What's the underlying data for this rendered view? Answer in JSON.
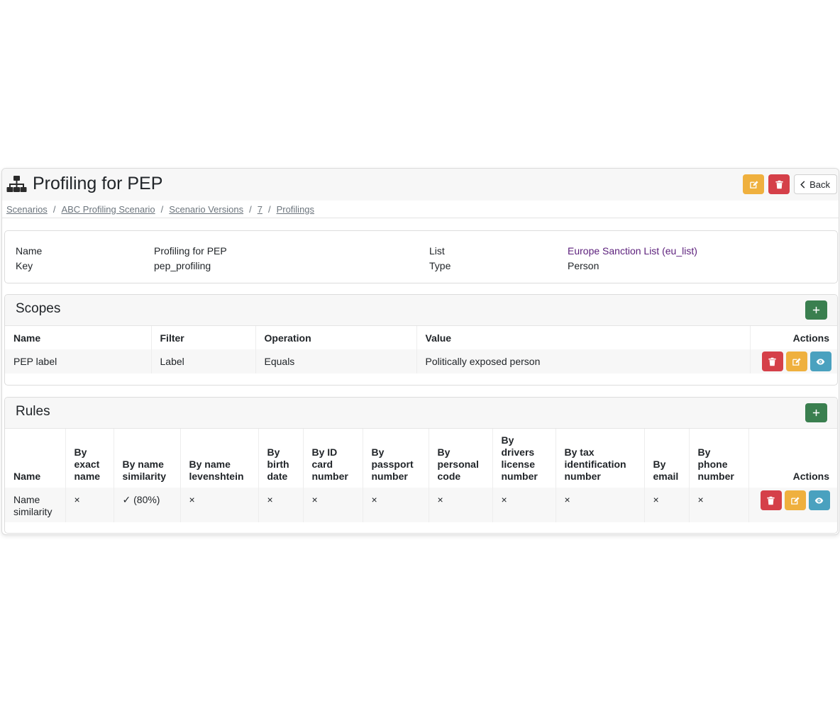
{
  "header": {
    "title": "Profiling for PEP",
    "back_label": "Back"
  },
  "breadcrumb": [
    "Scenarios",
    "ABC Profiling Scenario",
    "Scenario Versions",
    "7",
    "Profilings"
  ],
  "details": {
    "name_label": "Name",
    "name_value": "Profiling for PEP",
    "key_label": "Key",
    "key_value": "pep_profiling",
    "list_label": "List",
    "list_value": "Europe Sanction List (eu_list)",
    "type_label": "Type",
    "type_value": "Person"
  },
  "scopes": {
    "title": "Scopes",
    "columns": [
      "Name",
      "Filter",
      "Operation",
      "Value",
      "Actions"
    ],
    "rows": [
      {
        "name": "PEP label",
        "filter": "Label",
        "operation": "Equals",
        "value": "Politically exposed person"
      }
    ]
  },
  "rules": {
    "title": "Rules",
    "columns": [
      "Name",
      "By exact name",
      "By name similarity",
      "By name levenshtein",
      "By birth date",
      "By ID card number",
      "By passport number",
      "By personal code",
      "By drivers license number",
      "By tax identification number",
      "By email",
      "By phone number",
      "Actions"
    ],
    "rows": [
      {
        "cells": [
          "Name similarity",
          "×",
          "✓ (80%)",
          "×",
          "×",
          "×",
          "×",
          "×",
          "×",
          "×",
          "×",
          "×"
        ]
      }
    ]
  },
  "colors": {
    "warning": "#efb03e",
    "danger": "#d54049",
    "info": "#4aa1bf",
    "success": "#3a7f4f",
    "link": "#5b1e7b"
  },
  "icons": {
    "title": "sitemap-icon",
    "edit": "edit-icon",
    "delete": "trash-icon",
    "view": "eye-icon",
    "add": "plus-icon",
    "back": "chevron-left-icon"
  }
}
